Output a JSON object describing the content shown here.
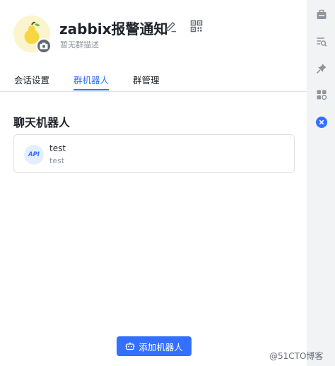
{
  "group": {
    "name": "zabbix报警通知",
    "description": "暂无群描述"
  },
  "tabs": [
    {
      "label": "会话设置",
      "active": false
    },
    {
      "label": "群机器人",
      "active": true
    },
    {
      "label": "群管理",
      "active": false
    }
  ],
  "section": {
    "title": "聊天机器人"
  },
  "bots": [
    {
      "avatar_text": "API",
      "name": "test",
      "subtitle": "test"
    }
  ],
  "add_button": {
    "label": "添加机器人"
  },
  "sidebar_icons": [
    "group-info-icon",
    "search-history-icon",
    "pin-icon",
    "group-apps-icon",
    "close-icon"
  ],
  "watermark": "@51CTO博客",
  "colors": {
    "accent": "#3370ff",
    "rail_bg": "#f2f3f5",
    "border": "#dee0e3",
    "muted_text": "#8f959e"
  }
}
